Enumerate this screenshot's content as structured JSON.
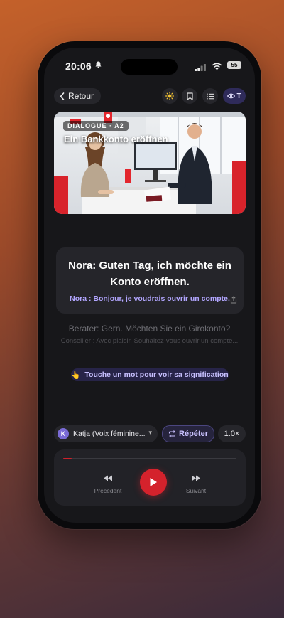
{
  "status_bar": {
    "time": "20:06",
    "battery": "55"
  },
  "nav": {
    "back_label": "Retour",
    "eye_toggle_label": "T"
  },
  "hero": {
    "tag": "DIALOGUE · A2",
    "title": "Ein Bankkonto eröffnen"
  },
  "current_line": {
    "german": "Nora: Guten Tag, ich möchte ein Konto eröffnen.",
    "french": "Nora : Bonjour, je voudrais ouvrir un compte."
  },
  "next_line": {
    "german": "Berater: Gern. Möchten Sie ein Girokonto?",
    "french": "Conseiller : Avec plaisir. Souhaitez-vous ouvrir un compte..."
  },
  "hint": {
    "emoji": "👆",
    "text": "Touche un mot pour voir sa signification"
  },
  "controls": {
    "voice_initial": "K",
    "voice_label": "Katja (Voix féminine...",
    "repeat_label": "Répéter",
    "speed_label": "1.0×"
  },
  "player": {
    "progress": 0.05,
    "previous_label": "Précédent",
    "next_label": "Suivant"
  },
  "colors": {
    "accent": "#d4222c",
    "highlight": "#b2a6ff",
    "background": "#17171a"
  },
  "icons": [
    "bell-icon",
    "signal-icon",
    "wifi-icon",
    "battery-icon",
    "chevron-left-icon",
    "sun-icon",
    "bookmark-icon",
    "list-icon",
    "eye-icon",
    "share-icon",
    "repeat-icon",
    "chevron-down-icon",
    "previous-icon",
    "play-icon",
    "next-icon"
  ]
}
